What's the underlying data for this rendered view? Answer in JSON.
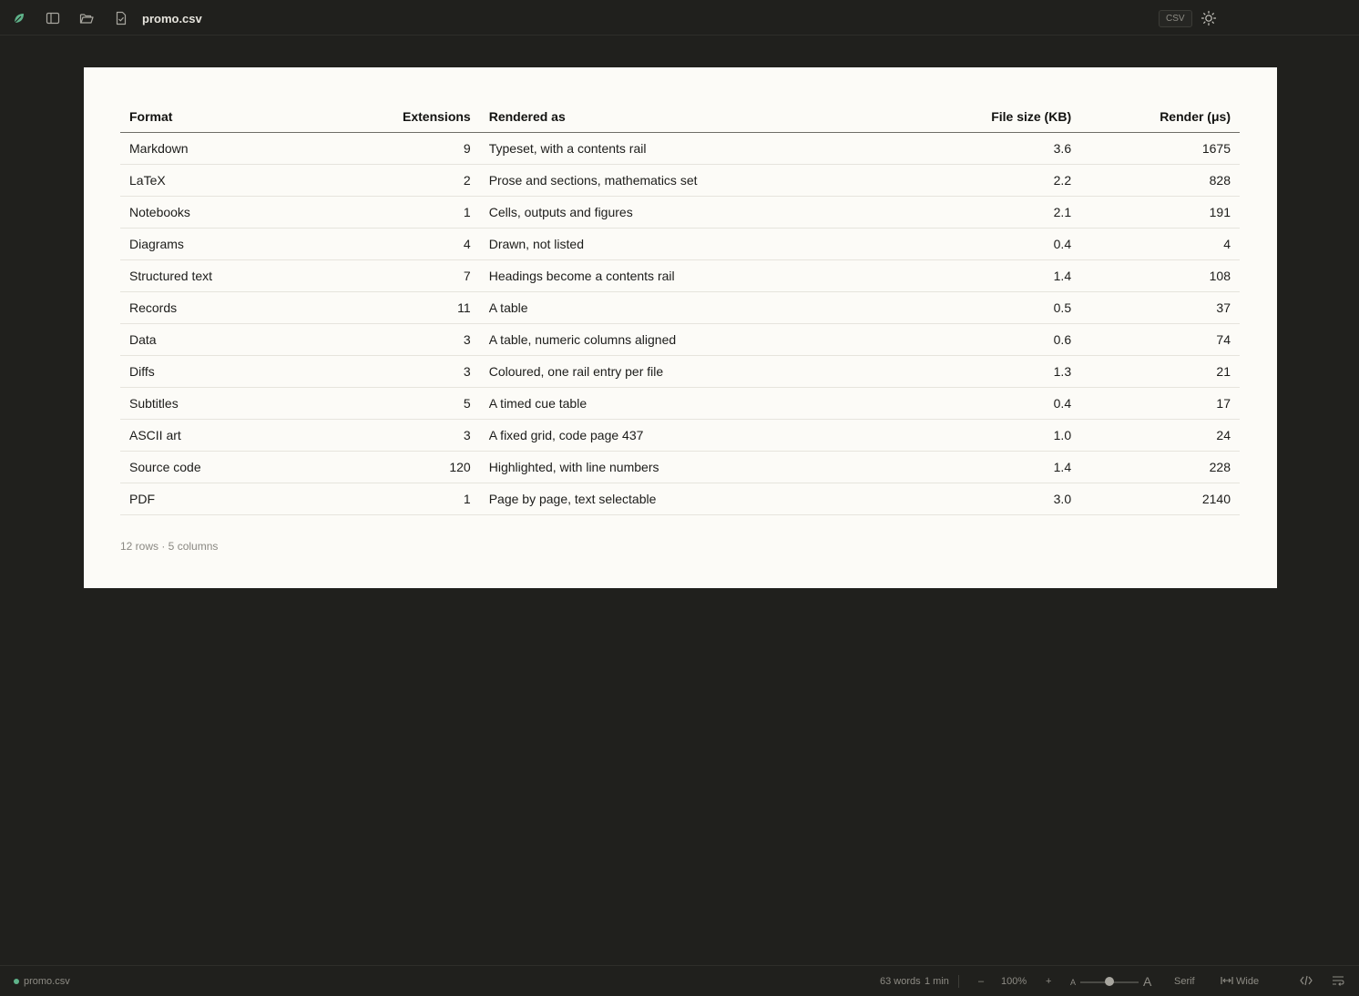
{
  "topbar": {
    "filename": "promo.csv",
    "format_badge": "CSV",
    "icons": [
      "leaf-logo-icon",
      "sidebar-toggle-icon",
      "folder-open-icon",
      "file-icon",
      "sun-icon"
    ]
  },
  "table": {
    "headers": [
      "Format",
      "Extensions",
      "Rendered as",
      "File size (KB)",
      "Render (μs)"
    ],
    "rows": [
      [
        "Markdown",
        "9",
        "Typeset, with a contents rail",
        "3.6",
        "1675"
      ],
      [
        "LaTeX",
        "2",
        "Prose and sections, mathematics set",
        "2.2",
        "828"
      ],
      [
        "Notebooks",
        "1",
        "Cells, outputs and figures",
        "2.1",
        "191"
      ],
      [
        "Diagrams",
        "4",
        "Drawn, not listed",
        "0.4",
        "4"
      ],
      [
        "Structured text",
        "7",
        "Headings become a contents rail",
        "1.4",
        "108"
      ],
      [
        "Records",
        "11",
        "A table",
        "0.5",
        "37"
      ],
      [
        "Data",
        "3",
        "A table, numeric columns aligned",
        "0.6",
        "74"
      ],
      [
        "Diffs",
        "3",
        "Coloured, one rail entry per file",
        "1.3",
        "21"
      ],
      [
        "Subtitles",
        "5",
        "A timed cue table",
        "0.4",
        "17"
      ],
      [
        "ASCII art",
        "3",
        "A fixed grid, code page 437",
        "1.0",
        "24"
      ],
      [
        "Source code",
        "120",
        "Highlighted, with line numbers",
        "1.4",
        "228"
      ],
      [
        "PDF",
        "1",
        "Page by page, text selectable",
        "3.0",
        "2140"
      ]
    ],
    "summary": "12 rows · 5 columns"
  },
  "statusbar": {
    "filename": "promo.csv",
    "words": "63 words",
    "read_time": "1 min",
    "zoom_out": "–",
    "zoom": "100%",
    "zoom_in": "+",
    "font_small": "A",
    "font_large": "A",
    "font_size_level": 0.5,
    "font_family": "Serif",
    "width_mode": "Wide"
  },
  "colors": {
    "background": "#20201d",
    "paper": "#fcfbf7",
    "accent": "#5fb38a"
  }
}
